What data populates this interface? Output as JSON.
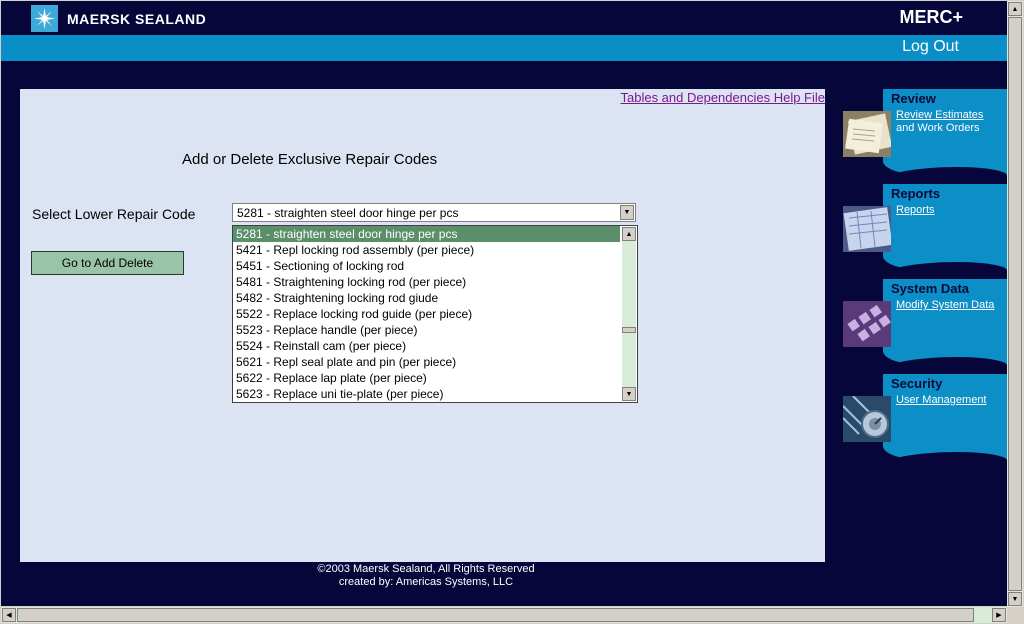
{
  "header": {
    "brand": "MAERSK SEALAND",
    "app_name": "MERC+",
    "logout": "Log Out"
  },
  "content": {
    "help_link": "Tables and Dependencies Help File",
    "heading": "Add or Delete Exclusive Repair Codes",
    "select_label": "Select Lower Repair Code",
    "select_value": "5281 - straighten steel door hinge per pcs",
    "options": [
      "5281 - straighten steel door hinge per pcs",
      "5421 - Repl locking rod assembly (per piece)",
      "5451 - Sectioning of locking rod",
      "5481 - Straightening locking rod (per piece)",
      "5482 - Straightening locking rod giude",
      "5522 - Replace locking rod guide (per piece)",
      "5523 - Replace handle (per piece)",
      "5524 - Reinstall cam (per piece)",
      "5621 - Repl seal plate and pin (per piece)",
      "5622 - Replace lap plate (per piece)",
      "5623 - Replace uni tie-plate (per piece)"
    ],
    "go_button": "Go to Add Delete"
  },
  "footer": {
    "line1": "©2003 Maersk Sealand, All Rights Reserved",
    "line2": "created by: Americas Systems, LLC"
  },
  "sidebar": {
    "review": {
      "title": "Review",
      "links": [
        "Review Estimates",
        "and Work Orders"
      ]
    },
    "reports": {
      "title": "Reports",
      "links": [
        "Reports"
      ]
    },
    "system_data": {
      "title": "System Data",
      "links": [
        "Modify System Data"
      ]
    },
    "security": {
      "title": "Security",
      "links": [
        "User Management"
      ]
    }
  },
  "colors": {
    "background": "#06063a",
    "accent": "#0a8ec6",
    "content_bg": "#dce4f4",
    "button": "#9ac4a8",
    "selected": "#5a8f6a",
    "link": "#7a1a8a"
  }
}
